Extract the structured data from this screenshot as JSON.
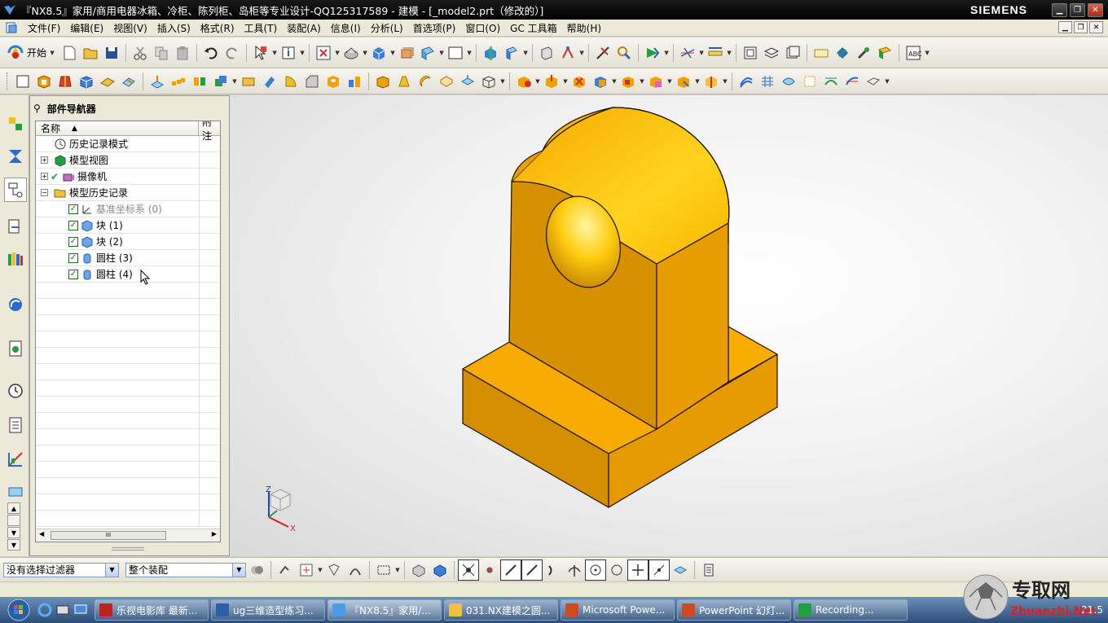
{
  "window": {
    "title": "『NX8.5』家用/商用电器冰箱、冷柜、陈列柜、岛柜等专业设计-QQ125317589 - 建模 - [_model2.prt（修改的）]",
    "brand": "SIEMENS"
  },
  "menu": {
    "items": [
      "文件(F)",
      "编辑(E)",
      "视图(V)",
      "插入(S)",
      "格式(R)",
      "工具(T)",
      "装配(A)",
      "信息(I)",
      "分析(L)",
      "首选项(P)",
      "窗口(O)",
      "GC 工具箱",
      "帮助(H)"
    ]
  },
  "toolbar": {
    "start_label": "开始"
  },
  "navigator": {
    "title": "部件导航器",
    "col_name": "名称",
    "col_note": "附注",
    "rows": [
      {
        "label": "历史记录模式"
      },
      {
        "label": "模型视图"
      },
      {
        "label": "摄像机"
      },
      {
        "label": "模型历史记录"
      },
      {
        "label": "基准坐标系 (0)"
      },
      {
        "label": "块 (1)"
      },
      {
        "label": "块 (2)"
      },
      {
        "label": "圆柱 (3)"
      },
      {
        "label": "圆柱 (4)"
      }
    ]
  },
  "triad": {
    "z": "Z",
    "x": "X"
  },
  "selection": {
    "filter": "没有选择过滤器",
    "scope": "整个装配"
  },
  "taskbar": {
    "tasks": [
      "乐视电影库 最新...",
      "ug三维造型练习...",
      "『NX8.5』家用/...",
      "031.NX建模之圆...",
      "Microsoft Powe...",
      "PowerPoint 幻灯...",
      "Recording..."
    ],
    "clock": "21:5"
  },
  "watermark": {
    "text": "专取网",
    "url": "Zhuanzhi.Net"
  },
  "colors": {
    "part": "#f0a000",
    "part_dark": "#c57a00",
    "part_light": "#ffc820",
    "titlebar": "#000000"
  }
}
